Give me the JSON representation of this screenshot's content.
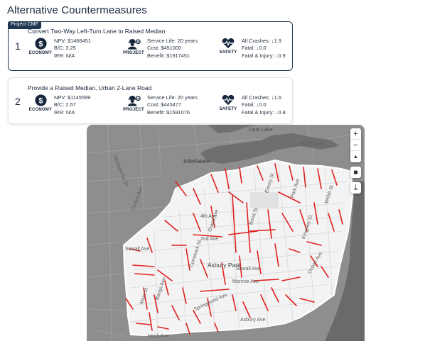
{
  "page": {
    "title": "Alternative Countermeasures"
  },
  "countermeasures": [
    {
      "tag": "Project CMF",
      "number": "1",
      "title": "Convert Two-Way Left-Turn Lane to Raised Median",
      "economy": {
        "label": "ECONOMY",
        "npv": "NPV: $1466451",
        "bc": "B/C: 3.25",
        "irr": "IRR: N/A"
      },
      "project": {
        "label": "PROJECT",
        "service_life": "Service Life: 20 years",
        "cost": "Cost: $451000",
        "benefit": "Benefit: $1917451"
      },
      "safety": {
        "label": "SAFETY",
        "all_crashes": "All Crashes: ↓1.9",
        "fatal": "Fatal: ↓0.0",
        "fatal_injury": "Fatal & Injury: ↓0.9"
      }
    },
    {
      "number": "2",
      "title": "Provide a Raised Median, Urban 2-Lane Road",
      "economy": {
        "label": "ECONOMY",
        "npv": "NPV: $1145599",
        "bc": "B/C: 2.57",
        "irr": "IRR: N/A"
      },
      "project": {
        "label": "PROJECT",
        "service_life": "Service Life: 20 years",
        "cost": "Cost: $445477",
        "benefit": "Benefit: $1591076"
      },
      "safety": {
        "label": "SAFETY",
        "all_crashes": "All Crashes: ↓1.6",
        "fatal": "Fatal: ↓0.0",
        "fatal_injury": "Fatal & Injury: ↓0.8"
      }
    }
  ],
  "map": {
    "labels": {
      "deal_lake": "Deal Lake",
      "interlaken": "Interlaken",
      "euclid_ave": "Euclid Ave",
      "wickapecko_dr": "Wickapecko Dr",
      "asbury_park": "Asbury Park",
      "fourth_ave": "4th Ave",
      "second_ave": "2nd Ave",
      "sewall_ave": "Sewall Ave",
      "monroe_ave": "Monroe Ave",
      "emory_st": "Emory St",
      "park_ave": "Park Ave",
      "webb_st": "Webb St",
      "bond_st": "Bond St",
      "ocean_ave": "Ocean Ave",
      "asbury_ave": "Asbury Ave",
      "heck_ave": "Heck Ave",
      "bangs_ave": "Bangs Ave",
      "main_st": "Main St",
      "springwood_ave": "Springwood Ave",
      "corlies_ave": "Corlies Ave",
      "comstock_st": "Comstock St",
      "grand_ave": "Grand Ave",
      "kingsley_st": "Kingsley St"
    },
    "controls": {
      "zoom_in": "+",
      "zoom_out": "−",
      "compass": "▲",
      "layers": "■",
      "download": "⤓"
    }
  }
}
